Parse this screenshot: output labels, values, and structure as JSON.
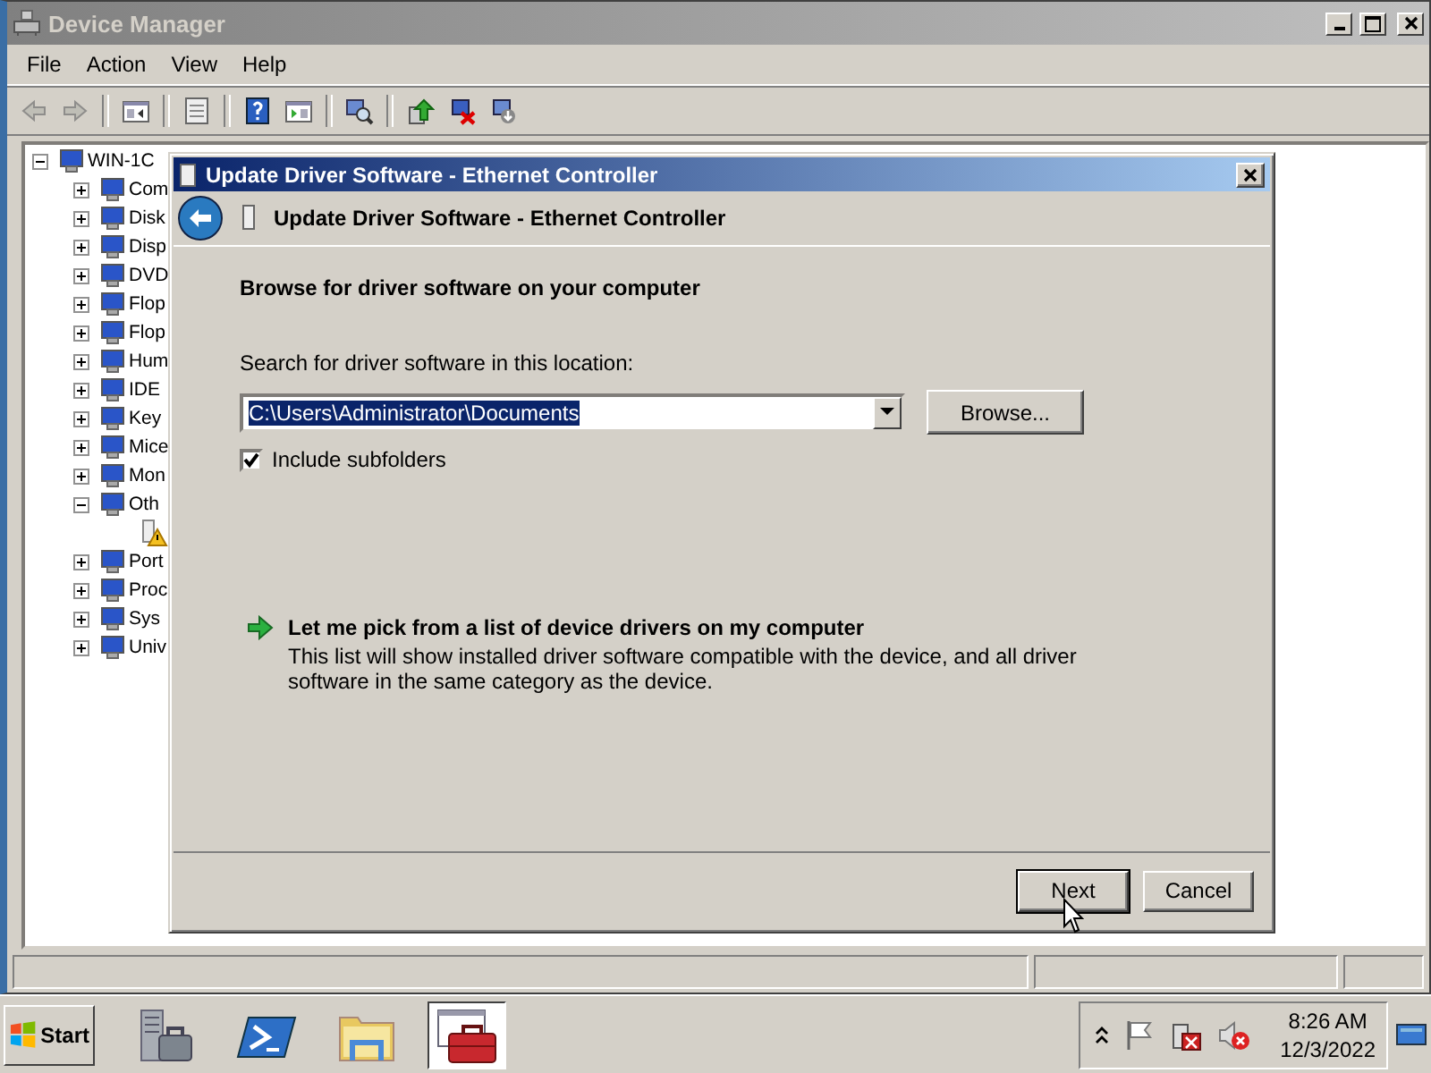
{
  "main_window": {
    "title": "Device Manager",
    "menu": [
      "File",
      "Action",
      "View",
      "Help"
    ],
    "toolbar": [
      {
        "kind": "back",
        "disabled": true
      },
      {
        "kind": "forward",
        "disabled": true
      },
      {
        "kind": "separator",
        "disabled": false
      },
      {
        "kind": "console-tree",
        "disabled": false
      },
      {
        "kind": "separator",
        "disabled": false
      },
      {
        "kind": "properties",
        "disabled": false
      },
      {
        "kind": "separator",
        "disabled": false
      },
      {
        "kind": "help",
        "disabled": false
      },
      {
        "kind": "action-pane",
        "disabled": false
      },
      {
        "kind": "separator",
        "disabled": false
      },
      {
        "kind": "scan",
        "disabled": false
      },
      {
        "kind": "separator",
        "disabled": false
      },
      {
        "kind": "update",
        "disabled": false
      },
      {
        "kind": "uninstall",
        "disabled": false
      },
      {
        "kind": "disable",
        "disabled": false
      }
    ]
  },
  "tree": {
    "label": "WIN-1C",
    "expanded": true,
    "children": [
      {
        "label": "Com",
        "expanded": false
      },
      {
        "label": "Disk",
        "expanded": false
      },
      {
        "label": "Disp",
        "expanded": false
      },
      {
        "label": "DVD",
        "expanded": false
      },
      {
        "label": "Flop",
        "expanded": false
      },
      {
        "label": "Flop",
        "expanded": false
      },
      {
        "label": "Hum",
        "expanded": false
      },
      {
        "label": "IDE",
        "expanded": false
      },
      {
        "label": "Key",
        "expanded": false
      },
      {
        "label": "Mice",
        "expanded": false
      },
      {
        "label": "Mon",
        "expanded": false
      },
      {
        "label": "Oth",
        "expanded": true,
        "children": [
          {
            "kind": "warning"
          }
        ]
      },
      {
        "label": "Port",
        "expanded": false
      },
      {
        "label": "Proc",
        "expanded": false
      },
      {
        "label": "Sys",
        "expanded": false
      },
      {
        "label": "Univ",
        "expanded": false
      }
    ]
  },
  "dialog": {
    "title": "Update Driver Software - Ethernet Controller",
    "heading": "Update Driver Software - Ethernet Controller",
    "section_title": "Browse for driver software on your computer",
    "location_label": "Search for driver software in this location:",
    "location": {
      "value": "C:\\Users\\Administrator\\Documents",
      "selected": true
    },
    "browse_button": "Browse...",
    "include_subfolders": {
      "label": "Include subfolders",
      "checked": true
    },
    "pick_option": {
      "title": "Let me pick from a list of device drivers on my computer",
      "description": "This list will show installed driver software compatible with the device, and all driver software in the same category as the device."
    },
    "buttons": [
      {
        "label": "Next",
        "default": true
      },
      {
        "label": "Cancel",
        "default": false
      }
    ]
  },
  "taskbar": {
    "start": "Start",
    "quick_launch": [
      {
        "kind": "server-manager",
        "selected": false
      },
      {
        "kind": "powershell",
        "selected": false
      },
      {
        "kind": "explorer",
        "selected": false
      },
      {
        "kind": "toolbox",
        "selected": true
      }
    ],
    "tray_icons": [
      {
        "kind": "chevron"
      },
      {
        "kind": "flag"
      },
      {
        "kind": "network-error"
      },
      {
        "kind": "sound-muted"
      }
    ],
    "time": "8:26 AM",
    "date": "12/3/2022"
  }
}
